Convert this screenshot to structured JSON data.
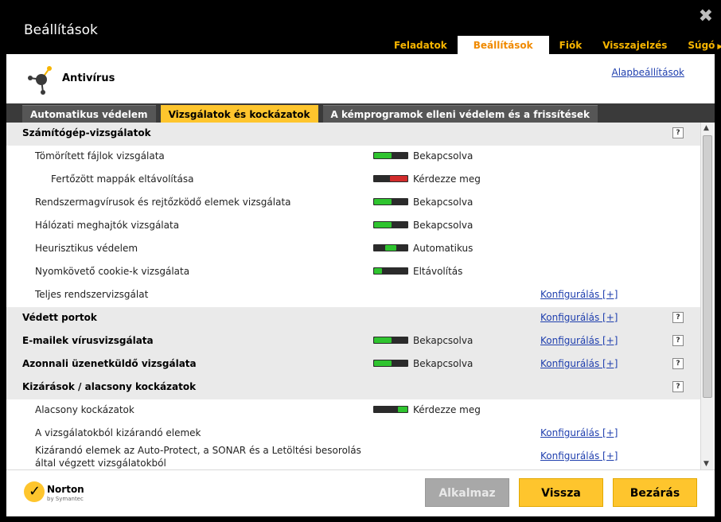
{
  "window": {
    "title": "Beállítások",
    "close": "✖"
  },
  "topnav": [
    {
      "label": "Feladatok",
      "active": false
    },
    {
      "label": "Beállítások",
      "active": true
    },
    {
      "label": "Fiók",
      "active": false
    },
    {
      "label": "Visszajelzés",
      "active": false
    },
    {
      "label": "Súgó",
      "active": false,
      "arrow": "▶"
    }
  ],
  "product": {
    "name": "Antivírus",
    "defaults_link": "Alapbeállítások"
  },
  "tabs": [
    {
      "label": "Automatikus védelem",
      "active": false
    },
    {
      "label": "Vizsgálatok és kockázatok",
      "active": true
    },
    {
      "label": "A kémprogramok elleni védelem és a frissítések",
      "active": false
    }
  ],
  "help_glyph": "?",
  "colors": {
    "green": "#2fc42f",
    "red": "#d12b2b",
    "yellow": "#fec52d"
  },
  "rows": [
    {
      "label": "Számítógép-vizsgálatok",
      "section": true,
      "help": true
    },
    {
      "label": "Tömörített fájlok vizsgálata",
      "indent": 1,
      "toggle": "on",
      "status": "Bekapcsolva"
    },
    {
      "label": "Fertőzött mappák eltávolítása",
      "indent": 2,
      "toggle": "ask",
      "status": "Kérdezze meg"
    },
    {
      "label": "Rendszermagvírusok és rejtőzködő elemek vizsgálata",
      "indent": 1,
      "toggle": "on",
      "status": "Bekapcsolva"
    },
    {
      "label": "Hálózati meghajtók vizsgálata",
      "indent": 1,
      "toggle": "on",
      "status": "Bekapcsolva"
    },
    {
      "label": "Heurisztikus védelem",
      "indent": 1,
      "toggle": "auto",
      "status": "Automatikus"
    },
    {
      "label": "Nyomkövető cookie-k vizsgálata",
      "indent": 1,
      "toggle": "remove",
      "status": "Eltávolítás"
    },
    {
      "label": "Teljes rendszervizsgálat",
      "indent": 1,
      "config": "Konfigurálás [+]"
    },
    {
      "label": "Védett portok",
      "section": true,
      "config": "Konfigurálás [+]",
      "help": true
    },
    {
      "label": "E-mailek vírusvizsgálata",
      "section": true,
      "toggle": "on",
      "status": "Bekapcsolva",
      "config": "Konfigurálás [+]",
      "help": true
    },
    {
      "label": "Azonnali üzenetküldő vizsgálata",
      "section": true,
      "toggle": "on",
      "status": "Bekapcsolva",
      "config": "Konfigurálás [+]",
      "help": true
    },
    {
      "label": "Kizárások / alacsony kockázatok",
      "section": true,
      "help": true
    },
    {
      "label": "Alacsony kockázatok",
      "indent": 1,
      "toggle": "ask-right",
      "status": "Kérdezze meg"
    },
    {
      "label": "A vizsgálatokból kizárandó elemek",
      "indent": 1,
      "config": "Konfigurálás [+]"
    },
    {
      "label": "Kizárandó elemek az Auto-Protect, a SONAR és a Letöltési besorolás által végzett vizsgálatokból",
      "indent": 1,
      "multi": true,
      "config": "Konfigurálás [+]"
    }
  ],
  "footer": {
    "brand": "Norton",
    "brand_sub": "by Symantec",
    "apply": "Alkalmaz",
    "back": "Vissza",
    "close": "Bezárás"
  },
  "scrollbar": {
    "up": "▲",
    "down": "▼"
  }
}
